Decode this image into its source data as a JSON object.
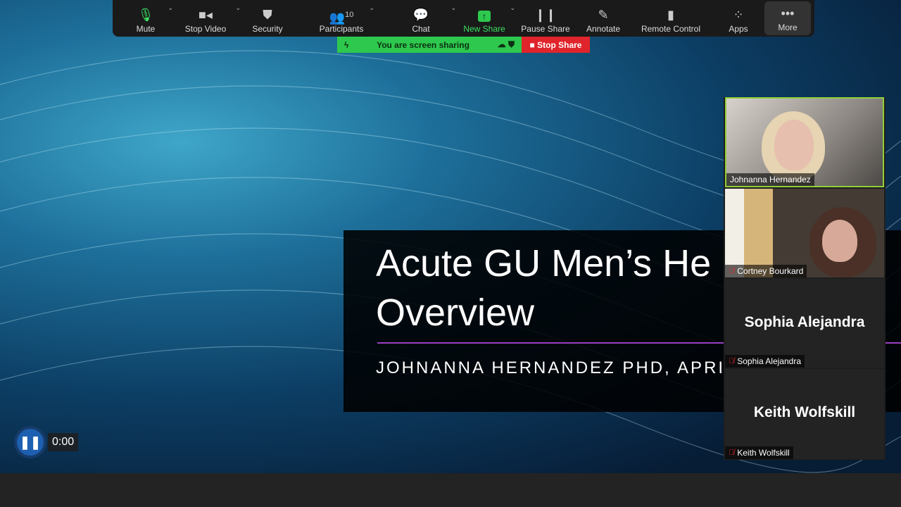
{
  "toolbar": {
    "items": [
      {
        "label": "Mute",
        "icon": "microphone-icon"
      },
      {
        "label": "Stop Video",
        "icon": "video-camera-icon"
      },
      {
        "label": "Security",
        "icon": "shield-icon"
      },
      {
        "label": "Participants",
        "icon": "participants-icon",
        "count": "10"
      },
      {
        "label": "Chat",
        "icon": "chat-icon"
      },
      {
        "label": "New Share",
        "icon": "share-arrow-icon"
      },
      {
        "label": "Pause Share",
        "icon": "pause-icon"
      },
      {
        "label": "Annotate",
        "icon": "pencil-icon"
      },
      {
        "label": "Remote Control",
        "icon": "mouse-icon"
      },
      {
        "label": "Apps",
        "icon": "apps-icon"
      },
      {
        "label": "More",
        "icon": "ellipsis-icon"
      }
    ]
  },
  "share_banner": {
    "status": "You are screen sharing",
    "stop_label": "Stop Share"
  },
  "slide": {
    "title_line1": "Acute GU Men’s He",
    "title_line2": "Overview",
    "subtitle": "JOHNANNA HERNANDEZ PHD, APRI"
  },
  "gallery": [
    {
      "name": "Johnanna Hernandez"
    },
    {
      "name": "Cortney Bourkard"
    },
    {
      "name": "Sophia Alejandra",
      "display": "Sophia Alejandra"
    },
    {
      "name": "Keith Wolfskill",
      "display": "Keith Wolfskill"
    }
  ],
  "player": {
    "time": "0:00"
  }
}
